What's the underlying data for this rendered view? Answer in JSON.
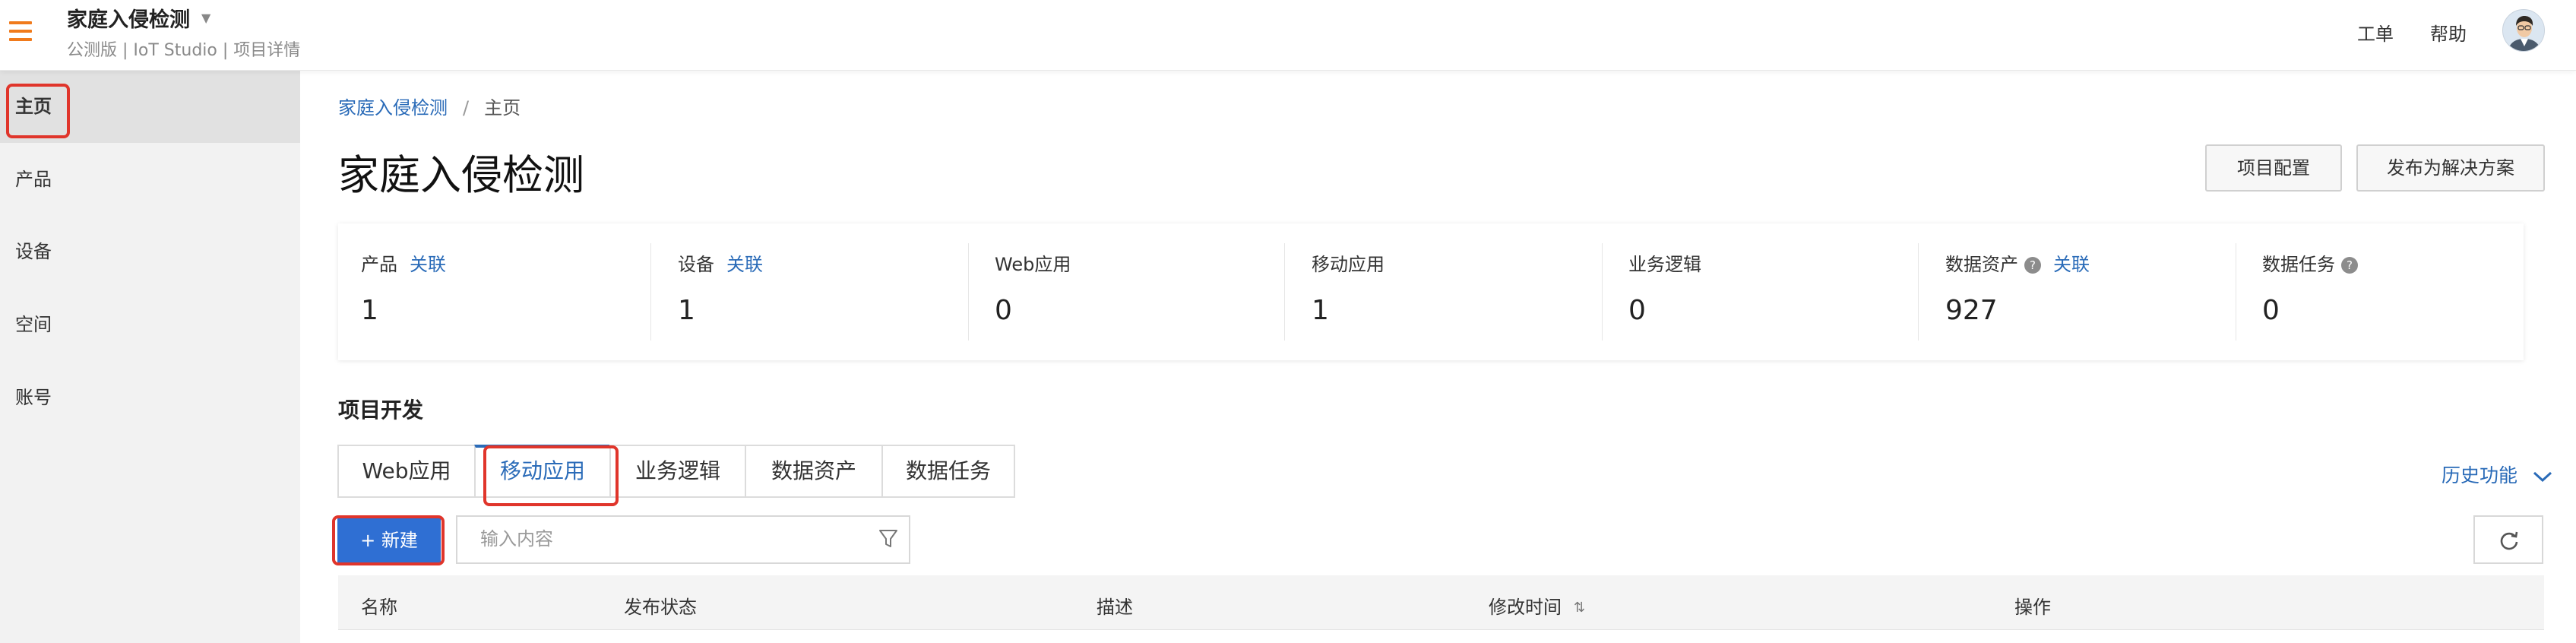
{
  "header": {
    "project_title": "家庭入侵检测",
    "subtitle": "公测版 | IoT Studio | 项目详情",
    "ticket": "工单",
    "help": "帮助",
    "brand_color": "#f07a1b",
    "icons": [
      "menu-icon",
      "dropdown-caret-icon",
      "avatar"
    ]
  },
  "sidebar": {
    "items": [
      {
        "label": "主页",
        "active": true
      },
      {
        "label": "产品"
      },
      {
        "label": "设备"
      },
      {
        "label": "空间"
      },
      {
        "label": "账号"
      }
    ]
  },
  "breadcrumb": {
    "parent": "家庭入侵检测",
    "separator": "/",
    "current": "主页"
  },
  "page": {
    "title": "家庭入侵检测",
    "config_button": "项目配置",
    "publish_button": "发布为解决方案"
  },
  "stats": [
    {
      "label": "产品",
      "link": "关联",
      "value": "1"
    },
    {
      "label": "设备",
      "link": "关联",
      "value": "1"
    },
    {
      "label": "Web应用",
      "value": "0"
    },
    {
      "label": "移动应用",
      "value": "1"
    },
    {
      "label": "业务逻辑",
      "value": "0"
    },
    {
      "label": "数据资产",
      "help": "?",
      "link": "关联",
      "value": "927"
    },
    {
      "label": "数据任务",
      "help": "?",
      "value": "0"
    }
  ],
  "dev": {
    "section_title": "项目开发",
    "tabs": [
      {
        "label": "Web应用"
      },
      {
        "label": "移动应用",
        "active": true
      },
      {
        "label": "业务逻辑"
      },
      {
        "label": "数据资产"
      },
      {
        "label": "数据任务"
      }
    ],
    "history": "历史功能",
    "new_button": "+ 新建",
    "search_placeholder": "输入内容",
    "table_headers": [
      "名称",
      "发布状态",
      "描述",
      "修改时间",
      "操作"
    ]
  },
  "colors": {
    "accent": "#2a6bb8",
    "primary_button": "#2f6fd3",
    "highlight": "#e0352b"
  }
}
